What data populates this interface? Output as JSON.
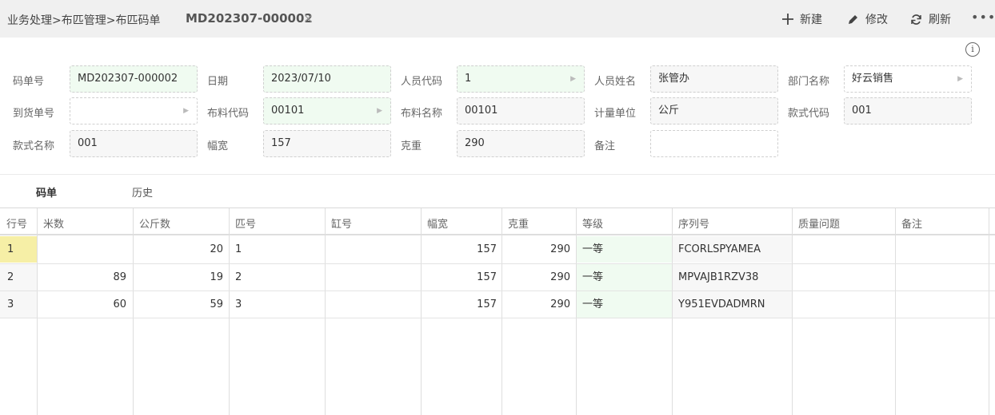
{
  "breadcrumb": "业务处理>布匹管理>布匹码单",
  "doc_tab": {
    "title": "MD202307-000002",
    "close": "×"
  },
  "toolbar": {
    "new": "新建",
    "edit": "修改",
    "refresh": "刷新",
    "more": "•••"
  },
  "info_icon": "i",
  "form": {
    "code_no": {
      "label": "码单号",
      "value": "MD202307-000002"
    },
    "date": {
      "label": "日期",
      "value": "2023/07/10"
    },
    "staff_code": {
      "label": "人员代码",
      "value": "1"
    },
    "staff_name": {
      "label": "人员姓名",
      "value": "张管办"
    },
    "dept_name": {
      "label": "部门名称",
      "value": "好云销售"
    },
    "arrival_no": {
      "label": "到货单号",
      "value": ""
    },
    "fabric_code": {
      "label": "布料代码",
      "value": "00101"
    },
    "fabric_name": {
      "label": "布料名称",
      "value": "00101"
    },
    "unit": {
      "label": "计量单位",
      "value": "公斤"
    },
    "style_code": {
      "label": "款式代码",
      "value": "001"
    },
    "style_name": {
      "label": "款式名称",
      "value": "001"
    },
    "width": {
      "label": "幅宽",
      "value": "157"
    },
    "weight": {
      "label": "克重",
      "value": "290"
    },
    "remark": {
      "label": "备注",
      "value": ""
    }
  },
  "tabs": [
    "码单",
    "历史"
  ],
  "table": {
    "headers": [
      "行号",
      "米数",
      "公斤数",
      "匹号",
      "缸号",
      "幅宽",
      "克重",
      "等级",
      "序列号",
      "质量问题",
      "备注"
    ],
    "rows": [
      {
        "no": "1",
        "meters": "",
        "kg": "20",
        "piece": "1",
        "vat": "",
        "width": "157",
        "weight": "290",
        "grade": "一等",
        "serial": "FCORLSPYAMEA",
        "quality": "",
        "remark": ""
      },
      {
        "no": "2",
        "meters": "89",
        "kg": "19",
        "piece": "2",
        "vat": "",
        "width": "157",
        "weight": "290",
        "grade": "一等",
        "serial": "MPVAJB1RZV38",
        "quality": "",
        "remark": ""
      },
      {
        "no": "3",
        "meters": "60",
        "kg": "59",
        "piece": "3",
        "vat": "",
        "width": "157",
        "weight": "290",
        "grade": "一等",
        "serial": "Y951EVDADMRN",
        "quality": "",
        "remark": ""
      }
    ]
  }
}
